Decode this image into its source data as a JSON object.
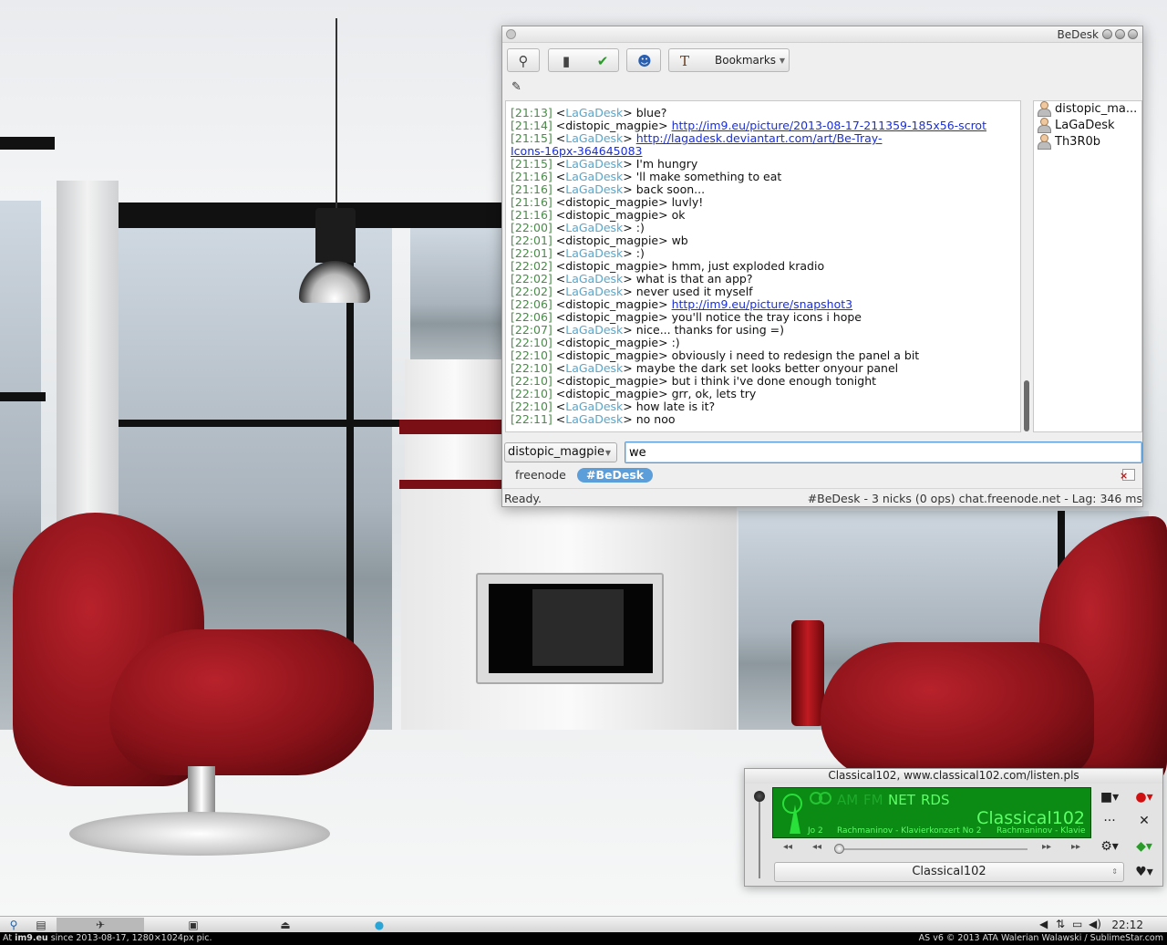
{
  "chat_window": {
    "title": "BeDesk",
    "toolbar": {
      "bookmarks_label": "Bookmarks"
    },
    "messages": [
      {
        "time": "[21:13]",
        "nick": "LaGaDesk",
        "text": "blue?"
      },
      {
        "time": "[21:14]",
        "nick": "distopic_magpie",
        "text": "",
        "link": "http://im9.eu/picture/2013-08-17-211359-185x56-scrot"
      },
      {
        "time": "[21:15]",
        "nick": "LaGaDesk",
        "text": "",
        "link": "http://lagadesk.deviantart.com/art/Be-Tray-",
        "link_cont": "Icons-16px-364645083"
      },
      {
        "time": "[21:15]",
        "nick": "LaGaDesk",
        "text": "I'm hungry"
      },
      {
        "time": "[21:16]",
        "nick": "LaGaDesk",
        "text": "'ll make something to eat"
      },
      {
        "time": "[21:16]",
        "nick": "LaGaDesk",
        "text": "back soon..."
      },
      {
        "time": "[21:16]",
        "nick": "distopic_magpie",
        "text": "luvly!"
      },
      {
        "time": "[21:16]",
        "nick": "distopic_magpie",
        "text": "ok"
      },
      {
        "time": "[22:00]",
        "nick": "LaGaDesk",
        "text": ":)"
      },
      {
        "time": "[22:01]",
        "nick": "distopic_magpie",
        "text": "wb"
      },
      {
        "time": "[22:01]",
        "nick": "LaGaDesk",
        "text": ":)"
      },
      {
        "time": "[22:02]",
        "nick": "distopic_magpie",
        "text": "hmm, just exploded kradio"
      },
      {
        "time": "[22:02]",
        "nick": "LaGaDesk",
        "text": "what is that an app?"
      },
      {
        "time": "[22:02]",
        "nick": "LaGaDesk",
        "text": "never used it myself"
      },
      {
        "time": "[22:06]",
        "nick": "distopic_magpie",
        "text": "",
        "link": "http://im9.eu/picture/snapshot3"
      },
      {
        "time": "[22:06]",
        "nick": "distopic_magpie",
        "text": "you'll notice the tray icons i hope"
      },
      {
        "time": "[22:07]",
        "nick": "LaGaDesk",
        "text": "nice... thanks for using =)"
      },
      {
        "time": "[22:10]",
        "nick": "distopic_magpie",
        "text": ":)"
      },
      {
        "time": "[22:10]",
        "nick": "distopic_magpie",
        "text": "obviously i need to redesign the panel a bit"
      },
      {
        "time": "[22:10]",
        "nick": "LaGaDesk",
        "text": "maybe the dark set looks better onyour panel"
      },
      {
        "time": "[22:10]",
        "nick": "distopic_magpie",
        "text": "but i think i've done enough tonight"
      },
      {
        "time": "[22:10]",
        "nick": "distopic_magpie",
        "text": "grr, ok, lets try"
      },
      {
        "time": "[22:10]",
        "nick": "LaGaDesk",
        "text": "how late is it?"
      },
      {
        "time": "[22:11]",
        "nick": "LaGaDesk",
        "text": "no noo"
      }
    ],
    "nicklist": [
      "distopic_ma...",
      "LaGaDesk",
      "Th3R0b"
    ],
    "input": {
      "nick": "distopic_magpie",
      "value": "we"
    },
    "tabs": {
      "server": "freenode",
      "channel": "#BeDesk"
    },
    "status": {
      "left": "Ready.",
      "right": "#BeDesk - 3 nicks (0 ops) chat.freenode.net - Lag: 346 ms"
    }
  },
  "radio": {
    "title": "Classical102, www.classical102.com/listen.pls",
    "bands": {
      "am": "AM",
      "fm": "FM",
      "net": "NET",
      "rds": "RDS"
    },
    "station": "Classical102",
    "lcd_left": "Jo 2",
    "lcd_mid": "Rachmaninov - Klavierkonzert No 2",
    "lcd_right": "Rachmaninov - Klavie",
    "selected_station": "Classical102"
  },
  "taskbar": {
    "clock": "22:12"
  },
  "footer": {
    "left_prefix": "At ",
    "left_site": "im9.eu",
    "left_rest": " since 2013-08-17, 1280×1024px pic.",
    "right": "AS v6 © 2013 ATA Walerian Walawski / SublimeStar.com"
  },
  "colors": {
    "timestamp": "#4a8a4a",
    "nick_lagadesk": "#5aa5c9",
    "link": "#1a2fd6",
    "active_tab": "#5b9ed9",
    "lcd_bg": "#0b8a14",
    "lcd_text": "#5dff68"
  },
  "icons": {
    "toolbar": [
      "search-icon",
      "channel-list-icon",
      "check-icon",
      "user-info-icon",
      "font-icon"
    ],
    "tray": [
      "volume-icon",
      "network-icon",
      "battery-icon",
      "speaker-icon"
    ]
  }
}
